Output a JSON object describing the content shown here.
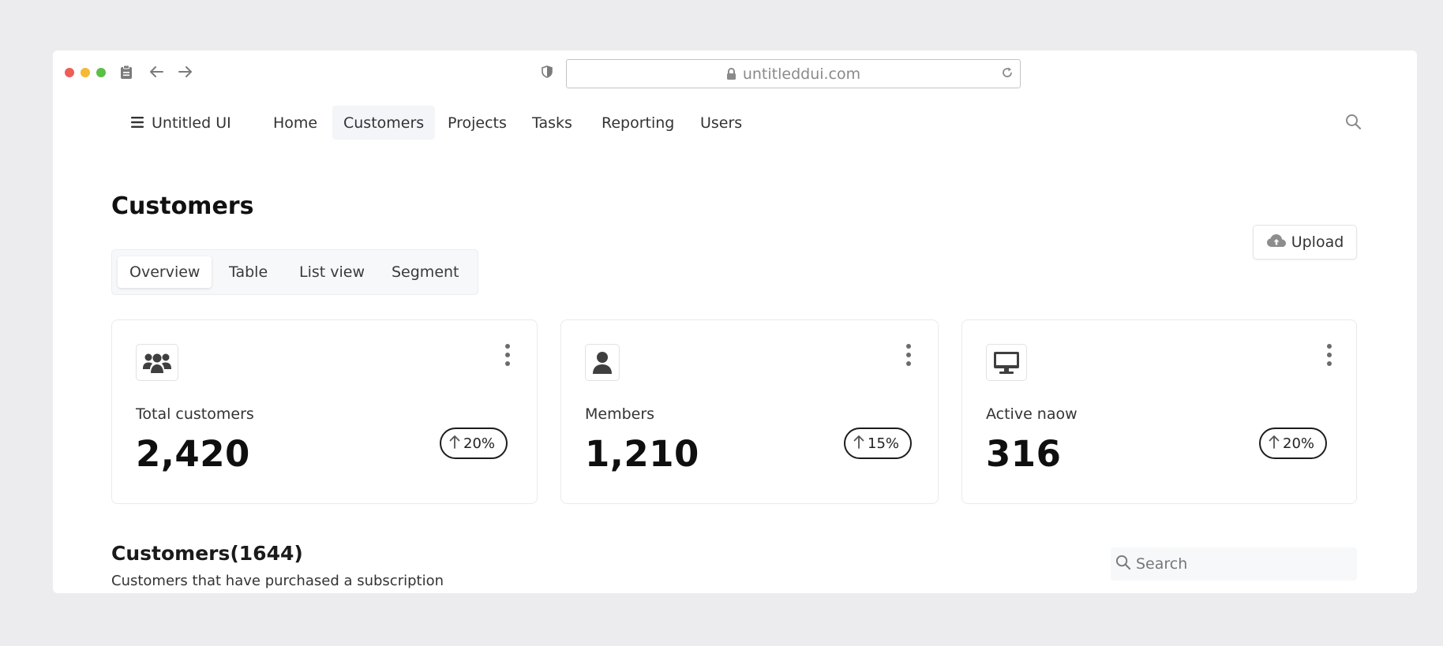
{
  "browser": {
    "url": "untitleddui.com",
    "traffic_lights": {
      "close": "#ee5e57",
      "minimize": "#f5b934",
      "maximize": "#5cbf46"
    }
  },
  "nav": {
    "brand": "Untitled UI",
    "items": [
      {
        "label": "Home",
        "active": false
      },
      {
        "label": "Customers",
        "active": true
      },
      {
        "label": "Projects",
        "active": false
      },
      {
        "label": "Tasks",
        "active": false
      },
      {
        "label": "Reporting",
        "active": false
      },
      {
        "label": "Users",
        "active": false
      }
    ]
  },
  "page": {
    "title": "Customers",
    "upload_label": "Upload",
    "tabs": [
      {
        "label": "Overview",
        "active": true
      },
      {
        "label": "Table",
        "active": false
      },
      {
        "label": "List view",
        "active": false
      },
      {
        "label": "Segment",
        "active": false
      }
    ]
  },
  "stats": [
    {
      "icon": "users-group-icon",
      "label": "Total customers",
      "value": "2,420",
      "trend": "20%"
    },
    {
      "icon": "user-icon",
      "label": "Members",
      "value": "1,210",
      "trend": "15%"
    },
    {
      "icon": "desktop-icon",
      "label": "Active naow",
      "value": "316",
      "trend": "20%"
    }
  ],
  "customers_section": {
    "title": "Customers(1644)",
    "subtitle": "Customers that have purchased a subscription",
    "search_placeholder": "Search"
  }
}
